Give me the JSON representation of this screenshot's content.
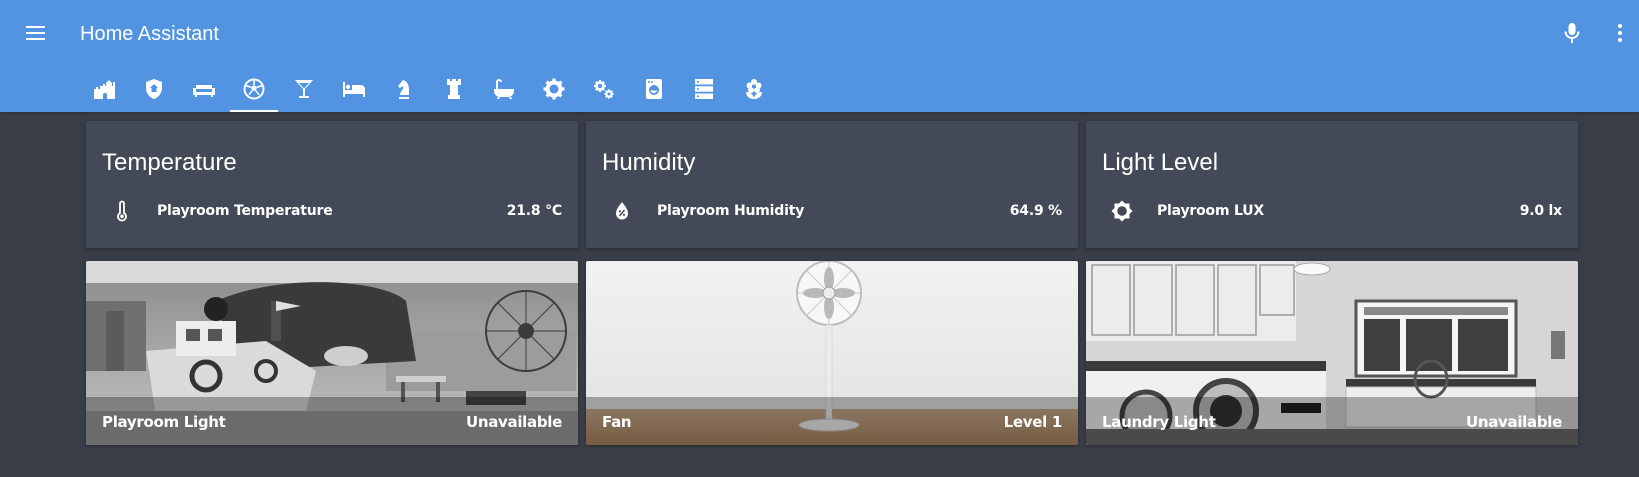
{
  "header": {
    "title": "Home Assistant",
    "menu_icon": "menu-icon",
    "mic_icon": "microphone-icon",
    "more_icon": "dots-vertical-icon",
    "background_color": "#5294e2"
  },
  "tabs": [
    {
      "icon": "castle-icon"
    },
    {
      "icon": "security-shield-icon"
    },
    {
      "icon": "sofa-icon"
    },
    {
      "icon": "soccer-icon",
      "active": true
    },
    {
      "icon": "martini-glass-icon"
    },
    {
      "icon": "bed-icon"
    },
    {
      "icon": "chess-knight-icon"
    },
    {
      "icon": "chess-rook-icon"
    },
    {
      "icon": "bathtub-icon"
    },
    {
      "icon": "settings-gear-icon"
    },
    {
      "icon": "settings-gears-icon"
    },
    {
      "icon": "washing-machine-icon"
    },
    {
      "icon": "server-icon"
    },
    {
      "icon": "flower-icon"
    }
  ],
  "entity_cards": [
    {
      "title": "Temperature",
      "icon": "thermometer-icon",
      "name": "Playroom Temperature",
      "state": "21.8 °C"
    },
    {
      "title": "Humidity",
      "icon": "water-percent-icon",
      "name": "Playroom Humidity",
      "state": "64.9 %"
    },
    {
      "title": "Light Level",
      "icon": "brightness-icon",
      "name": "Playroom LUX",
      "state": "9.0 lx"
    }
  ],
  "picture_cards": [
    {
      "name": "Playroom Light",
      "state": "Unavailable"
    },
    {
      "name": "Fan",
      "state": "Level 1"
    },
    {
      "name": "Laundry Light",
      "state": "Unavailable"
    }
  ],
  "colors": {
    "page_background": "#393d47",
    "card_background": "#434956",
    "text": "#ffffff"
  }
}
